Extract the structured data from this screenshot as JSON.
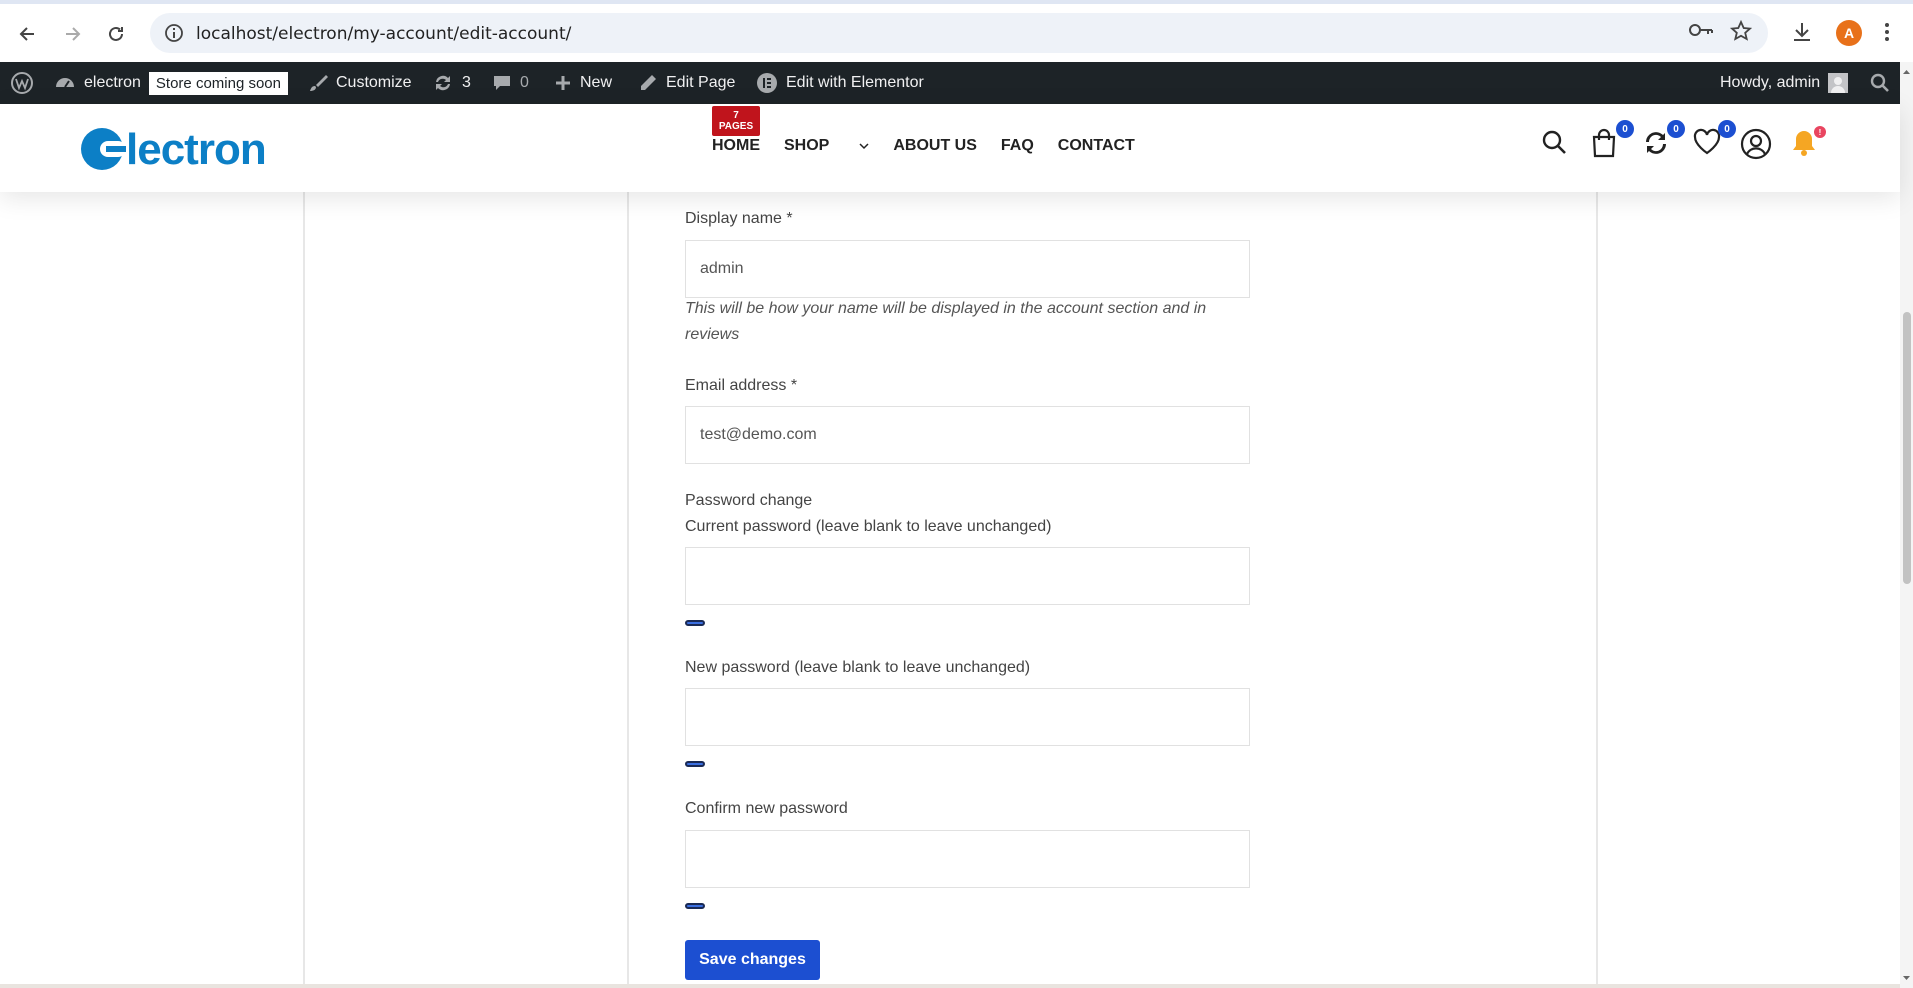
{
  "browser": {
    "url": "localhost/electron/my-account/edit-account/",
    "profile_initial": "A"
  },
  "admin_bar": {
    "site_name": "electron",
    "store_badge": "Store coming soon",
    "customize": "Customize",
    "updates_count": "3",
    "comments_count": "0",
    "new_label": "New",
    "edit_page": "Edit Page",
    "edit_elementor": "Edit with Elementor",
    "howdy": "Howdy, admin"
  },
  "header": {
    "logo": "electron",
    "pages_badge_count": "7",
    "pages_badge_label": "PAGES",
    "menu": [
      "HOME",
      "SHOP",
      "ABOUT US",
      "FAQ",
      "CONTACT"
    ],
    "cart_count": "0",
    "compare_count": "0",
    "wishlist_count": "0",
    "notification_count": "!"
  },
  "form": {
    "display_name_label": "Display name *",
    "display_name_value": "admin",
    "display_name_hint": "This will be how your name will be displayed in the account section and in reviews",
    "email_label": "Email address *",
    "email_value": "test@demo.com",
    "password_change_heading": "Password change",
    "current_password_label": "Current password (leave blank to leave unchanged)",
    "new_password_label": "New password (leave blank to leave unchanged)",
    "confirm_password_label": "Confirm new password",
    "save_button": "Save changes"
  },
  "colors": {
    "accent": "#1c4fd1",
    "brand_logo": "#0c7fc6",
    "admin_bar": "#1d2327",
    "badge_red": "#c0141c"
  }
}
